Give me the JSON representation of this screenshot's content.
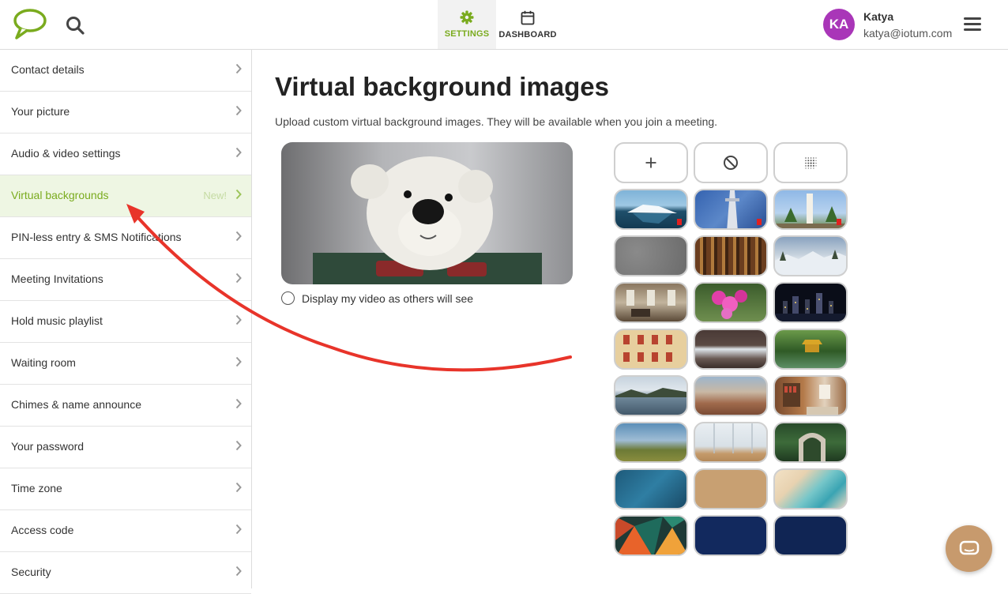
{
  "header": {
    "tabs": [
      {
        "label": "SETTINGS",
        "icon": "gear-icon",
        "active": true
      },
      {
        "label": "DASHBOARD",
        "icon": "calendar-icon",
        "active": false
      }
    ],
    "user": {
      "initials": "KA",
      "name": "Katya",
      "email": "katya@iotum.com",
      "avatar_color": "#a936b8"
    }
  },
  "sidebar": {
    "items": [
      {
        "label": "Contact details"
      },
      {
        "label": "Your picture"
      },
      {
        "label": "Audio & video settings"
      },
      {
        "label": "Virtual backgrounds",
        "badge": "New!",
        "active": true
      },
      {
        "label": "PIN-less entry & SMS Notifications"
      },
      {
        "label": "Meeting Invitations"
      },
      {
        "label": "Hold music playlist"
      },
      {
        "label": "Waiting room"
      },
      {
        "label": "Chimes & name announce"
      },
      {
        "label": "Your password"
      },
      {
        "label": "Time zone"
      },
      {
        "label": "Access code"
      },
      {
        "label": "Security"
      }
    ]
  },
  "main": {
    "title": "Virtual background images",
    "subtitle": "Upload custom virtual background images. They will be available when you join a meeting.",
    "mirror_label": "Display my video as others will see"
  },
  "colors": {
    "accent": "#7aab1e",
    "annotation": "#e8342a",
    "chat": "#c79a6d"
  }
}
